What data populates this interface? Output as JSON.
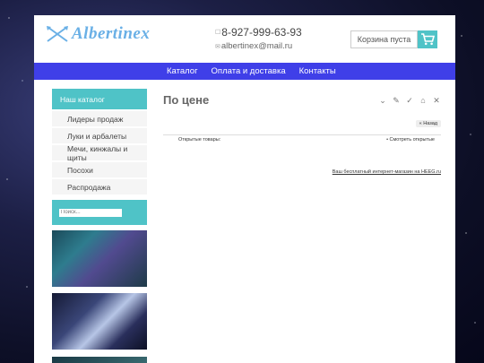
{
  "header": {
    "logo_text": "Albertinex",
    "phone": "8-927-999-63-93",
    "email": "albertinex@mail.ru",
    "cart_label": "Корзина пуста"
  },
  "nav": {
    "items": [
      "Каталог",
      "Оплата и доставка",
      "Контакты"
    ]
  },
  "sidebar": {
    "catalog_heading": "Наш каталог",
    "items": [
      "Лидеры продаж",
      "Луки и арбалеты",
      "Мечи, кинжалы и щиты",
      "Посохи",
      "Распродажа"
    ],
    "search_placeholder": "Поиск..."
  },
  "main": {
    "title": "По цене",
    "back_label": "Назад",
    "opened_label": "Открытые товары:",
    "view_opened_label": "Смотреть открытые",
    "footer_link": "Ваш бесплатный интернет-магазин на HEEG.ru"
  },
  "colors": {
    "accent": "#4fc3c7",
    "nav": "#3f3fe8",
    "logo": "#6ab0e6"
  }
}
